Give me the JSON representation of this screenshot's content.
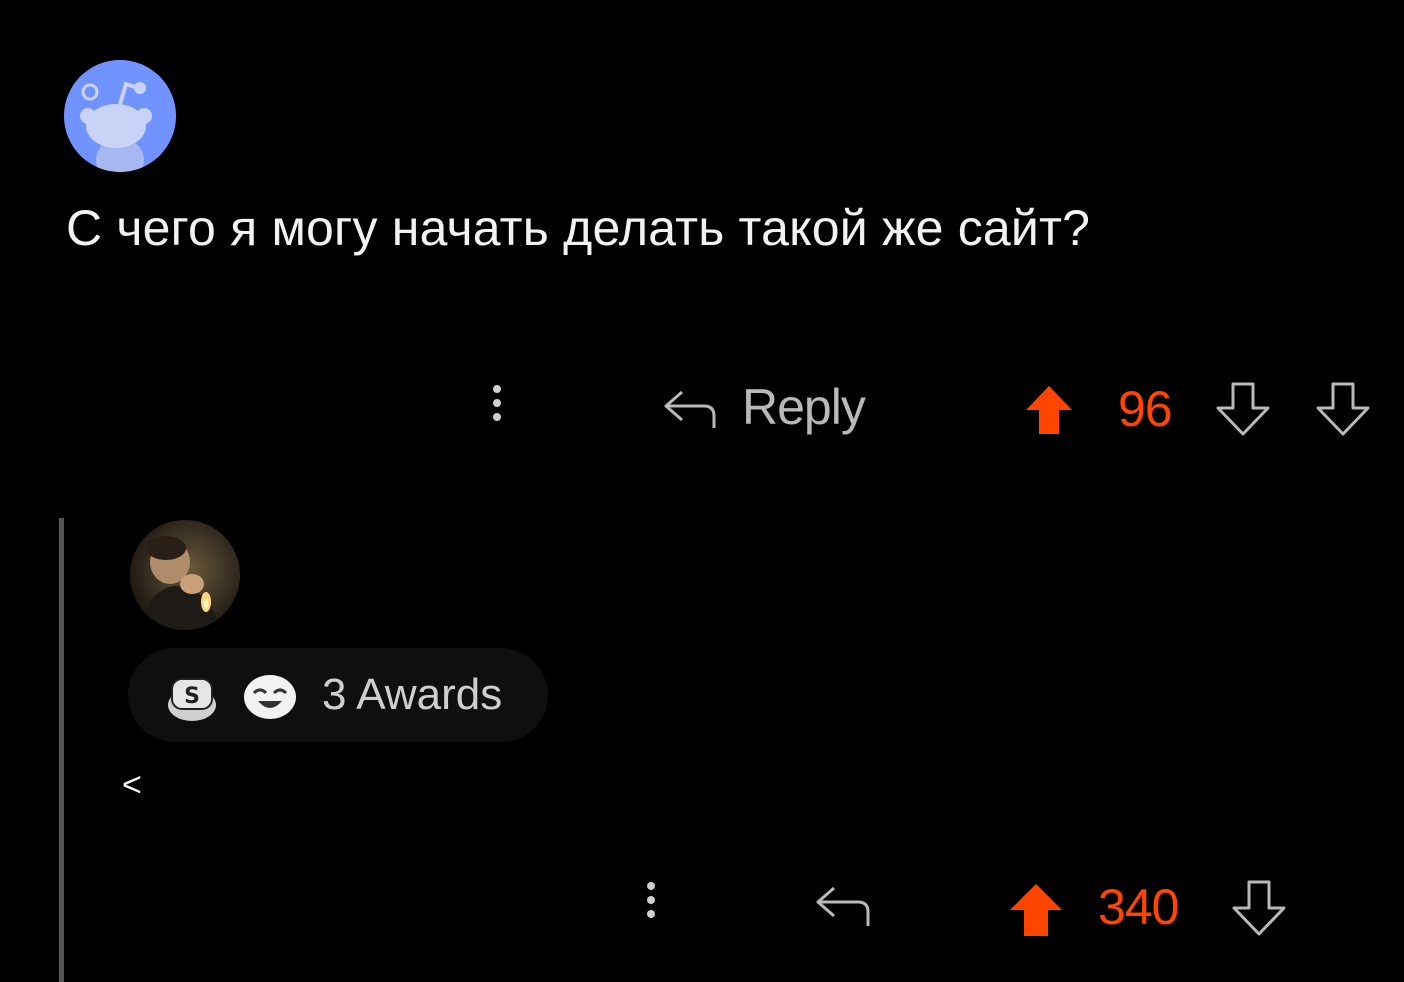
{
  "comment1": {
    "text": "С чего я могу начать делать такой же сайт?",
    "reply_label": "Reply",
    "score": "96",
    "avatar_icon": "reddit-snoo-avatar"
  },
  "comment2": {
    "awards_label": "3 Awards",
    "award_icons": [
      "silver-award-icon",
      "laughing-face-award-icon"
    ],
    "text": "<",
    "score": "340",
    "avatar_icon": "user-photo-avatar"
  },
  "colors": {
    "background": "#000000",
    "upvote": "#ff4500",
    "muted_text": "#b9b9b9",
    "snoo_avatar_bg": "#7193ff",
    "thread_line": "#555555"
  }
}
